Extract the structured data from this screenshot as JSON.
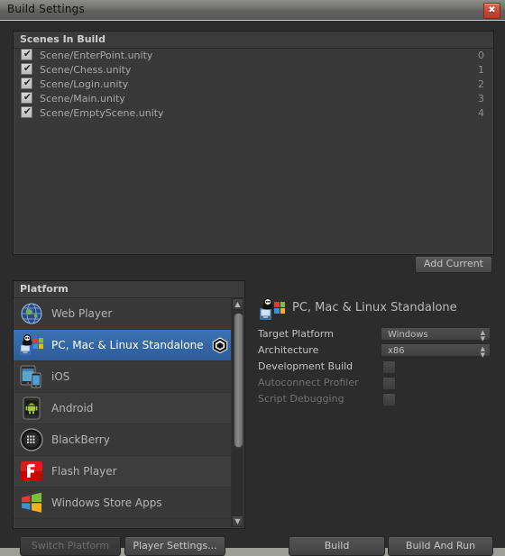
{
  "window": {
    "title": "Build Settings",
    "close_icon": "close-icon",
    "close_glyph": "✖"
  },
  "scenes_panel": {
    "header": "Scenes In Build",
    "check_glyph": "✔",
    "scenes": [
      {
        "name": "Scene/EnterPoint.unity",
        "index": "0",
        "checked": true
      },
      {
        "name": "Scene/Chess.unity",
        "index": "1",
        "checked": true
      },
      {
        "name": "Scene/Login.unity",
        "index": "2",
        "checked": true
      },
      {
        "name": "Scene/Main.unity",
        "index": "3",
        "checked": true
      },
      {
        "name": "Scene/EmptyScene.unity",
        "index": "4",
        "checked": true
      }
    ],
    "add_current_label": "Add Current"
  },
  "platform_panel": {
    "header": "Platform",
    "scroll_up_glyph": "▲",
    "scroll_down_glyph": "▼",
    "selected": "PC, Mac & Linux Standalone",
    "items": [
      {
        "label": "Web Player",
        "icon": "globe-icon",
        "selected": false
      },
      {
        "label": "PC, Mac & Linux Standalone",
        "icon": "standalone-icon",
        "selected": true
      },
      {
        "label": "iOS",
        "icon": "ios-icon",
        "selected": false
      },
      {
        "label": "Android",
        "icon": "android-icon",
        "selected": false
      },
      {
        "label": "BlackBerry",
        "icon": "blackberry-icon",
        "selected": false
      },
      {
        "label": "Flash Player",
        "icon": "flash-icon",
        "selected": false
      },
      {
        "label": "Windows Store Apps",
        "icon": "windows-icon",
        "selected": false
      }
    ]
  },
  "settings": {
    "platform_title": "PC, Mac & Linux Standalone",
    "platform_icon": "standalone-icon",
    "dropdown_arrows": "⇅",
    "fields": [
      {
        "label": "Target Platform",
        "type": "dropdown",
        "value": "Windows",
        "disabled": false
      },
      {
        "label": "Architecture",
        "type": "dropdown",
        "value": "x86",
        "disabled": false
      },
      {
        "label": "Development Build",
        "type": "checkbox",
        "checked": false,
        "disabled": false
      },
      {
        "label": "Autoconnect Profiler",
        "type": "checkbox",
        "checked": false,
        "disabled": true
      },
      {
        "label": "Script Debugging",
        "type": "checkbox",
        "checked": false,
        "disabled": true
      }
    ]
  },
  "buttons": {
    "switch_platform": "Switch Platform",
    "switch_platform_disabled": true,
    "player_settings": "Player Settings...",
    "build": "Build",
    "build_and_run": "Build And Run"
  },
  "colors": {
    "selection_blue": "#3b72b4",
    "panel_bg": "#393939",
    "window_bg": "#2c2c2c",
    "close_red": "#cf4a33"
  }
}
